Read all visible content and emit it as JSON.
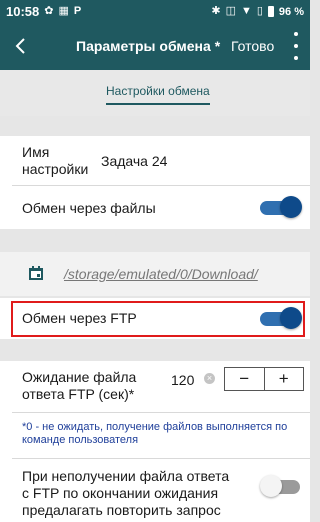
{
  "status_bar": {
    "time": "10:58",
    "battery_percent": "96 %"
  },
  "header": {
    "title": "Параметры обмена *",
    "done_label": "Готово"
  },
  "tabs": [
    {
      "label": "Настройки обмена",
      "active": true
    }
  ],
  "settings": {
    "name_label": "Имя\nнастройки",
    "name_value": "Задача 24",
    "file_exchange_label": "Обмен через файлы",
    "file_exchange_on": true,
    "folder_path": "/storage/emulated/0/Download/",
    "ftp_exchange_label": "Обмен через FTP",
    "ftp_exchange_on": true,
    "ftp_wait_label": "Ожидание файла\nответа FTP (сек)*",
    "ftp_wait_value": "120",
    "stepper_minus": "−",
    "stepper_plus": "+",
    "ftp_wait_note": "*0 - не ожидать, получение файлов выполняется по команде пользователя",
    "retry_label": "При неполучении файла ответа\nс FTP по окончании ожидания\nпредалагать повторить запрос",
    "retry_on": false
  },
  "colors": {
    "primary": "#1f5960",
    "toggle_on": "#0e4a8a",
    "highlight": "#e01b1b",
    "note": "#1f3f9a"
  }
}
